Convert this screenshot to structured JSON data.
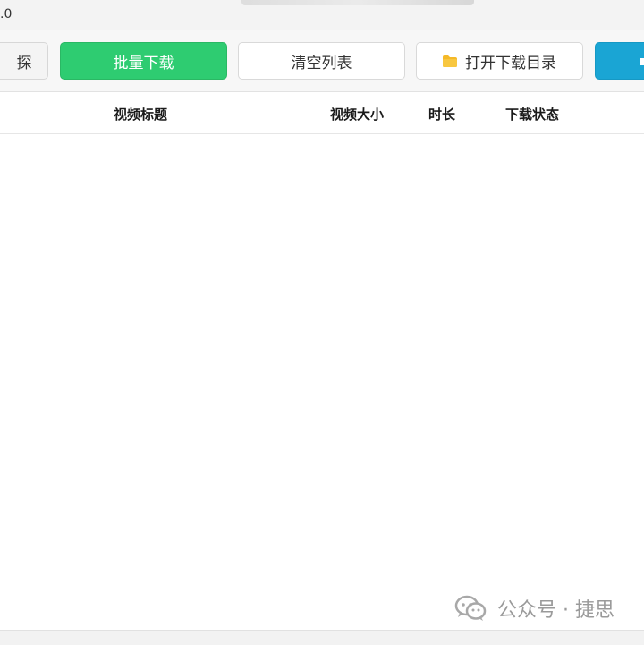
{
  "window": {
    "title_fragment": ".0"
  },
  "toolbar": {
    "explore_label": "探",
    "batch_download_label": "批量下载",
    "clear_list_label": "清空列表",
    "open_download_dir_label": "打开下载目录",
    "folder_icon": "folder-icon"
  },
  "table": {
    "columns": [
      "视频标题",
      "视频大小",
      "时长",
      "下载状态"
    ],
    "rows": []
  },
  "watermark": {
    "text": "公众号 · 捷思",
    "icon": "wechat-icon"
  },
  "colors": {
    "batch_button": "#2ecc71",
    "extra_button": "#1aa5d4",
    "folder": "#f5b928"
  }
}
